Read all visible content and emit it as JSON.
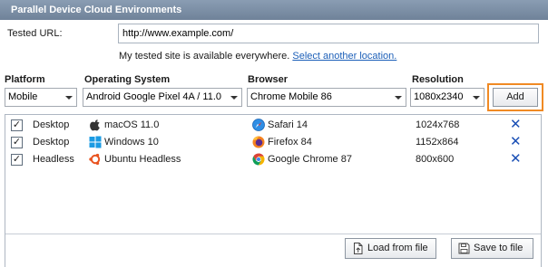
{
  "window": {
    "title": "Parallel Device Cloud Environments"
  },
  "url": {
    "label": "Tested URL:",
    "value": "http://www.example.com/",
    "availability_text": "My tested site is available everywhere.",
    "select_location_link": "Select another location."
  },
  "columns": {
    "platform": "Platform",
    "os": "Operating System",
    "browser": "Browser",
    "resolution": "Resolution"
  },
  "selectors": {
    "platform": "Mobile",
    "os": "Android Google Pixel 4A  / 11.0",
    "browser": "Chrome Mobile 86",
    "resolution": "1080x2340"
  },
  "add_button": "Add",
  "rows": [
    {
      "checked": true,
      "platform": "Desktop",
      "os": "macOS 11.0",
      "os_icon": "apple-icon",
      "browser": "Safari 14",
      "browser_icon": "safari-icon",
      "resolution": "1024x768"
    },
    {
      "checked": true,
      "platform": "Desktop",
      "os": "Windows 10",
      "os_icon": "windows-icon",
      "browser": "Firefox 84",
      "browser_icon": "firefox-icon",
      "resolution": "1152x864"
    },
    {
      "checked": true,
      "platform": "Headless",
      "os": "Ubuntu Headless",
      "os_icon": "ubuntu-icon",
      "browser": "Google Chrome 87",
      "browser_icon": "chrome-icon",
      "resolution": "800x600"
    }
  ],
  "checkmark": "✓",
  "delete_glyph": "✕",
  "footer": {
    "load_label": "Load from file",
    "save_label": "Save to file"
  },
  "colors": {
    "title_bar": "#7a8da4",
    "accent_orange": "#f08a24",
    "link_blue": "#1c5fb8",
    "delete_blue": "#1a4fb5"
  }
}
